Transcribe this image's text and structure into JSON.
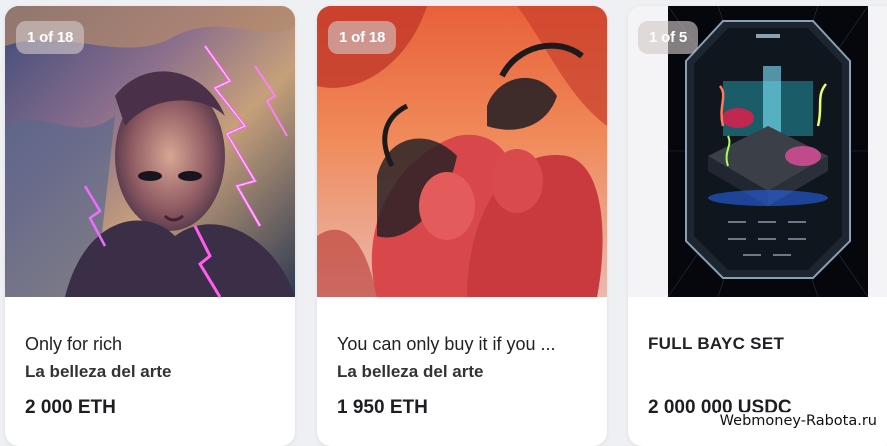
{
  "cards": [
    {
      "badge": "1 of 18",
      "title": "Only for rich",
      "collection": "La belleza del arte",
      "price": "2 000 ETH",
      "image_description": "portrait-lightning-artwork"
    },
    {
      "badge": "1 of 18",
      "title": "You can only buy it if you ...",
      "collection": "La belleza del arte",
      "price": "1 950 ETH",
      "image_description": "red-demons-artwork"
    },
    {
      "badge": "1 of 5",
      "title": "FULL BAYC SET",
      "collection": "",
      "price": "2 000 000 USDC",
      "image_description": "octagon-island-diorama"
    }
  ],
  "watermark": "Webmoney-Rabota.ru",
  "colors": {
    "page_bg": "#eef0f3",
    "card_bg": "#ffffff",
    "text": "#222226"
  }
}
